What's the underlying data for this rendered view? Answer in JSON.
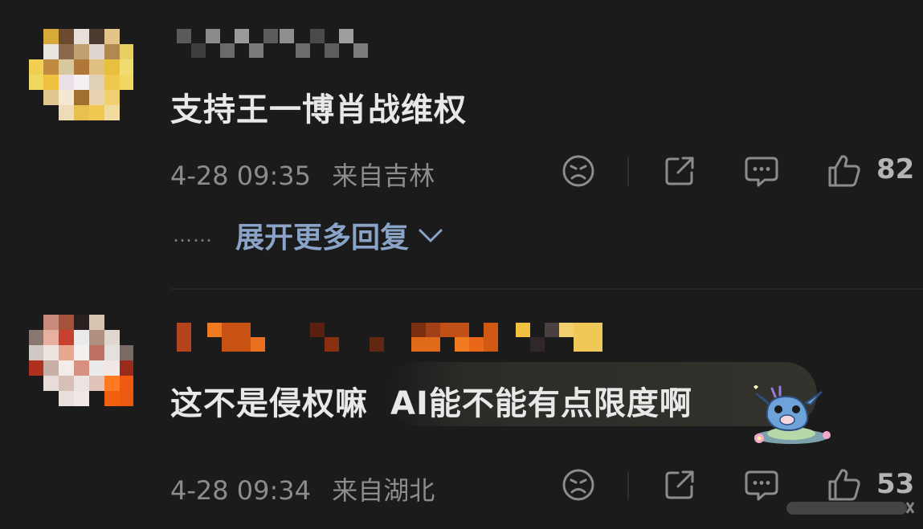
{
  "comments": [
    {
      "text": "支持王一博肖战维权",
      "date": "4-28 09:35",
      "location": "来自吉林",
      "likes": "82",
      "icons": [
        "dislike-face-icon",
        "share-icon",
        "reply-bubble-icon",
        "thumbs-up-icon"
      ],
      "expand_replies": {
        "dots": "……",
        "label": "展开更多回复",
        "icon": "chevron-down-icon"
      }
    },
    {
      "text_part1": "这不是侵权嘛",
      "text_part2": "AI能不能有点限度啊",
      "date": "4-28 09:34",
      "location": "来自湖北",
      "likes": "53",
      "icons": [
        "dislike-face-icon",
        "share-icon",
        "reply-bubble-icon",
        "thumbs-up-icon"
      ],
      "sticker": "stitch-sticker-icon"
    }
  ],
  "colors": {
    "background": "#1b1b1b",
    "text": "#e8e8e8",
    "meta": "#8c8c8c",
    "link": "#8aa4c8"
  }
}
